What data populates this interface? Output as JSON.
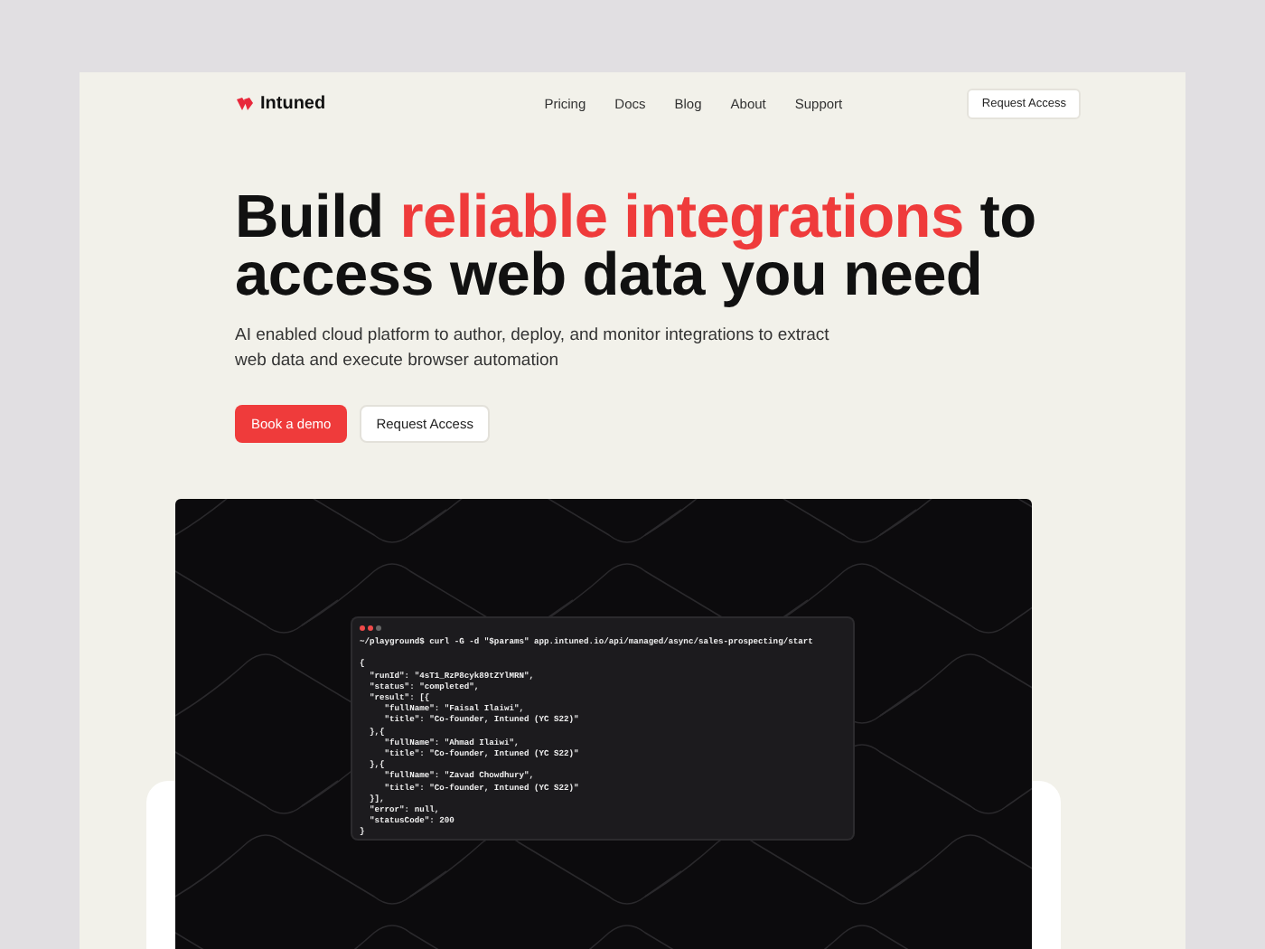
{
  "nav": {
    "brand": "Intuned",
    "links": [
      "Pricing",
      "Docs",
      "Blog",
      "About",
      "Support"
    ],
    "cta": "Request Access"
  },
  "hero": {
    "headline": {
      "before": "Build ",
      "highlight": "reliable integrations",
      "after": " to access web data you need"
    },
    "subtitle": "AI enabled cloud platform to author, deploy, and monitor integrations to extract web data and execute browser automation",
    "buttons": [
      {
        "label": "Book a demo",
        "kind": "primary"
      },
      {
        "label": "Request Access",
        "kind": "secondary"
      }
    ]
  },
  "terminal": {
    "lines": [
      "~/playground$ curl -G -d \"$params\" app.intuned.io/api/managed/async/sales-prospecting/start",
      "{",
      "  \"runId\": \"4sT1_RzP8cyk89tZYlMRN\",",
      "  \"status\": \"completed\",",
      "  \"result\": [{",
      "     \"fullName\": \"Faisal Ilaiwi\",",
      "     \"title\": \"Co-founder, Intuned (YC S22)\"",
      "  },{",
      "     \"fullName\": \"Ahmad Ilaiwi\",",
      "     \"title\": \"Co-founder, Intuned (YC S22)\"",
      "  },{",
      "     \"fullName\": \"Zavad Chowdhury\",",
      "     \"title\": \"Co-founder, Intuned (YC S22)\"",
      "  }],",
      "  \"error\": null,",
      "  \"statusCode\": 200",
      "}"
    ]
  }
}
